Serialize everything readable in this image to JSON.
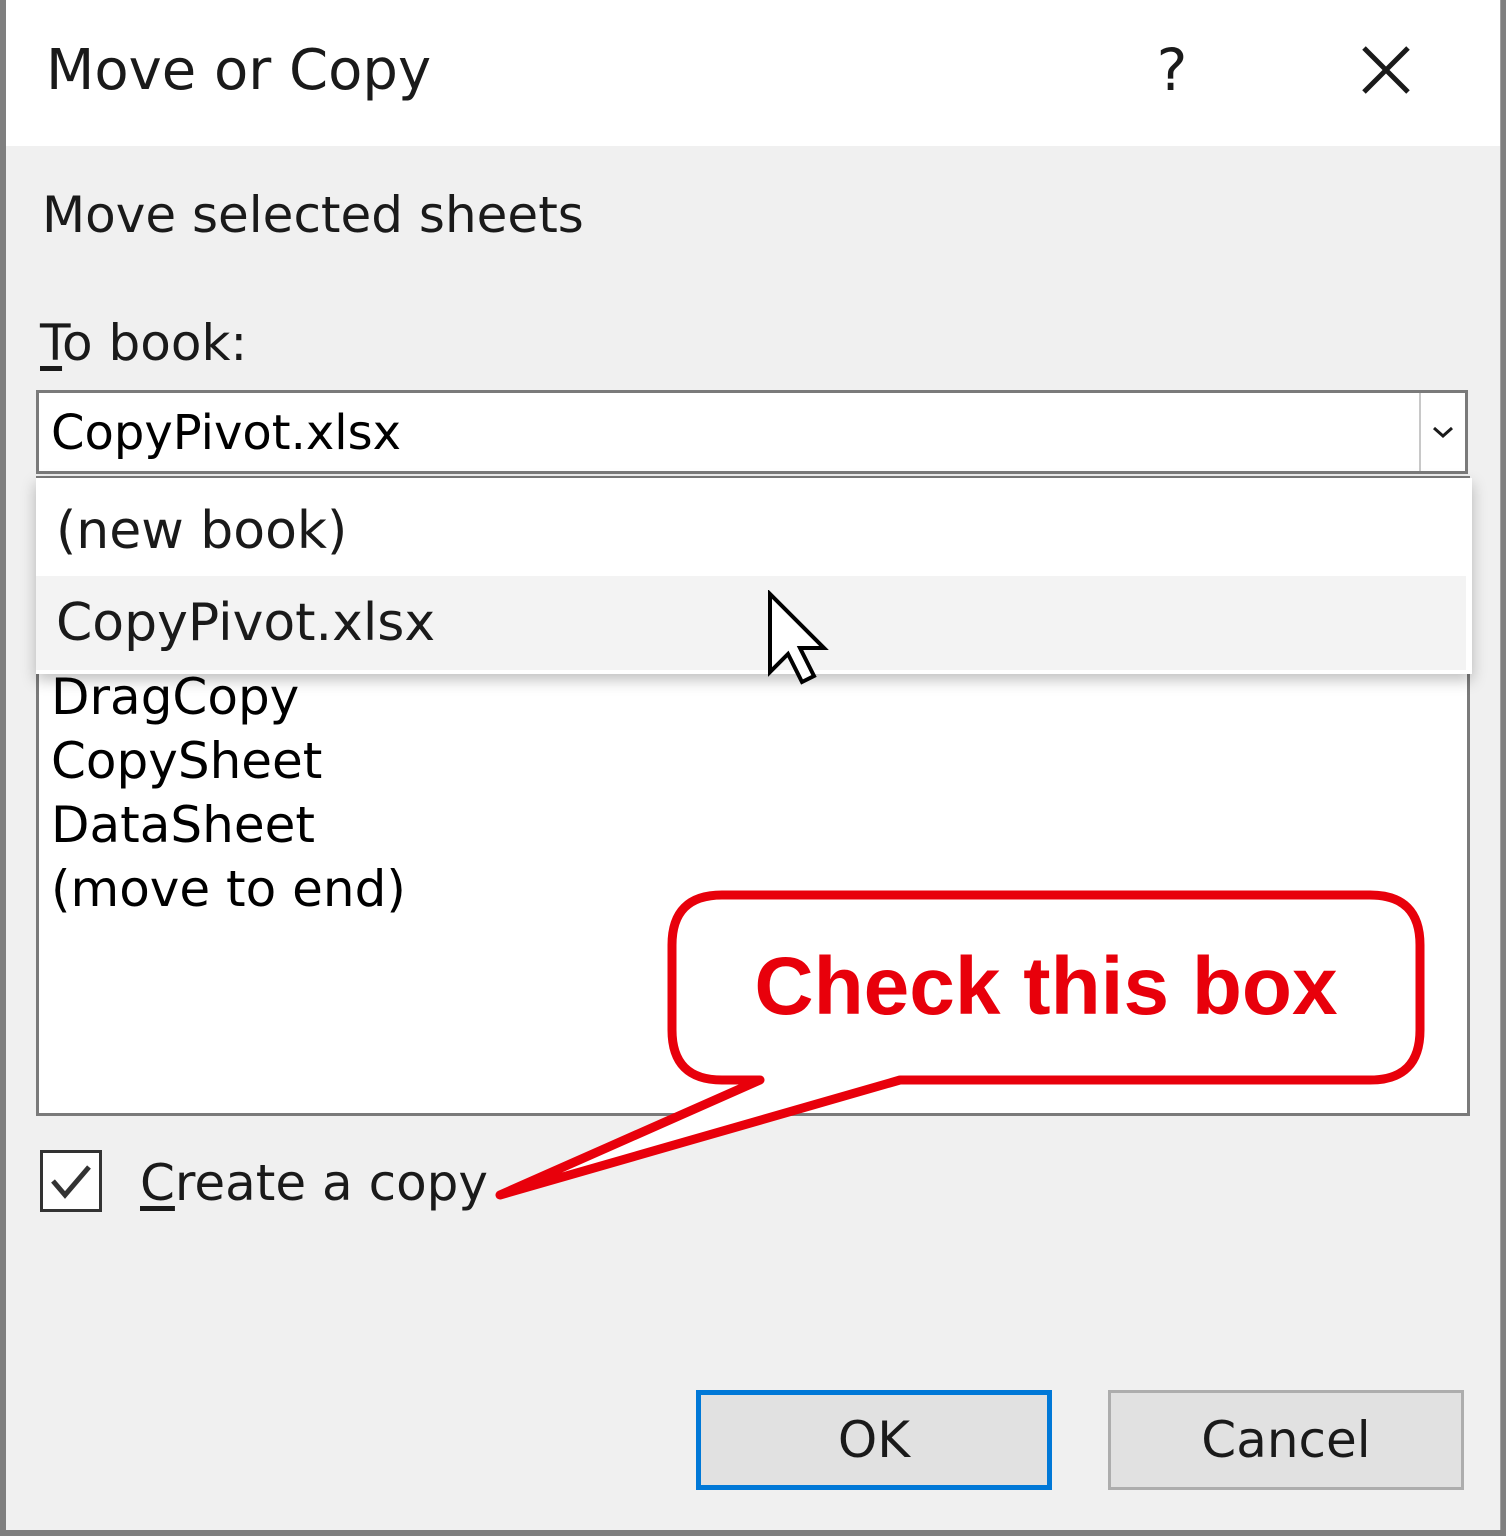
{
  "dialog": {
    "title": "Move or Copy",
    "help_label": "?",
    "subtitle": "Move selected sheets",
    "to_book_label_accel": "T",
    "to_book_label_rest": "o book:",
    "to_book_value": "CopyPivot.xlsx",
    "dropdown_options": [
      "(new book)",
      "CopyPivot.xlsx"
    ],
    "before_sheet_items": [
      "DragCopy",
      "CopySheet",
      "DataSheet",
      "(move to end)"
    ],
    "create_copy_accel": "C",
    "create_copy_rest": "reate a copy",
    "create_copy_checked": true,
    "ok_label": "OK",
    "cancel_label": "Cancel"
  },
  "annotation": {
    "callout_text": "Check this box",
    "color": "#e8000b"
  },
  "colors": {
    "focus_border": "#0078d7",
    "window_bg": "#f0f0f0"
  }
}
